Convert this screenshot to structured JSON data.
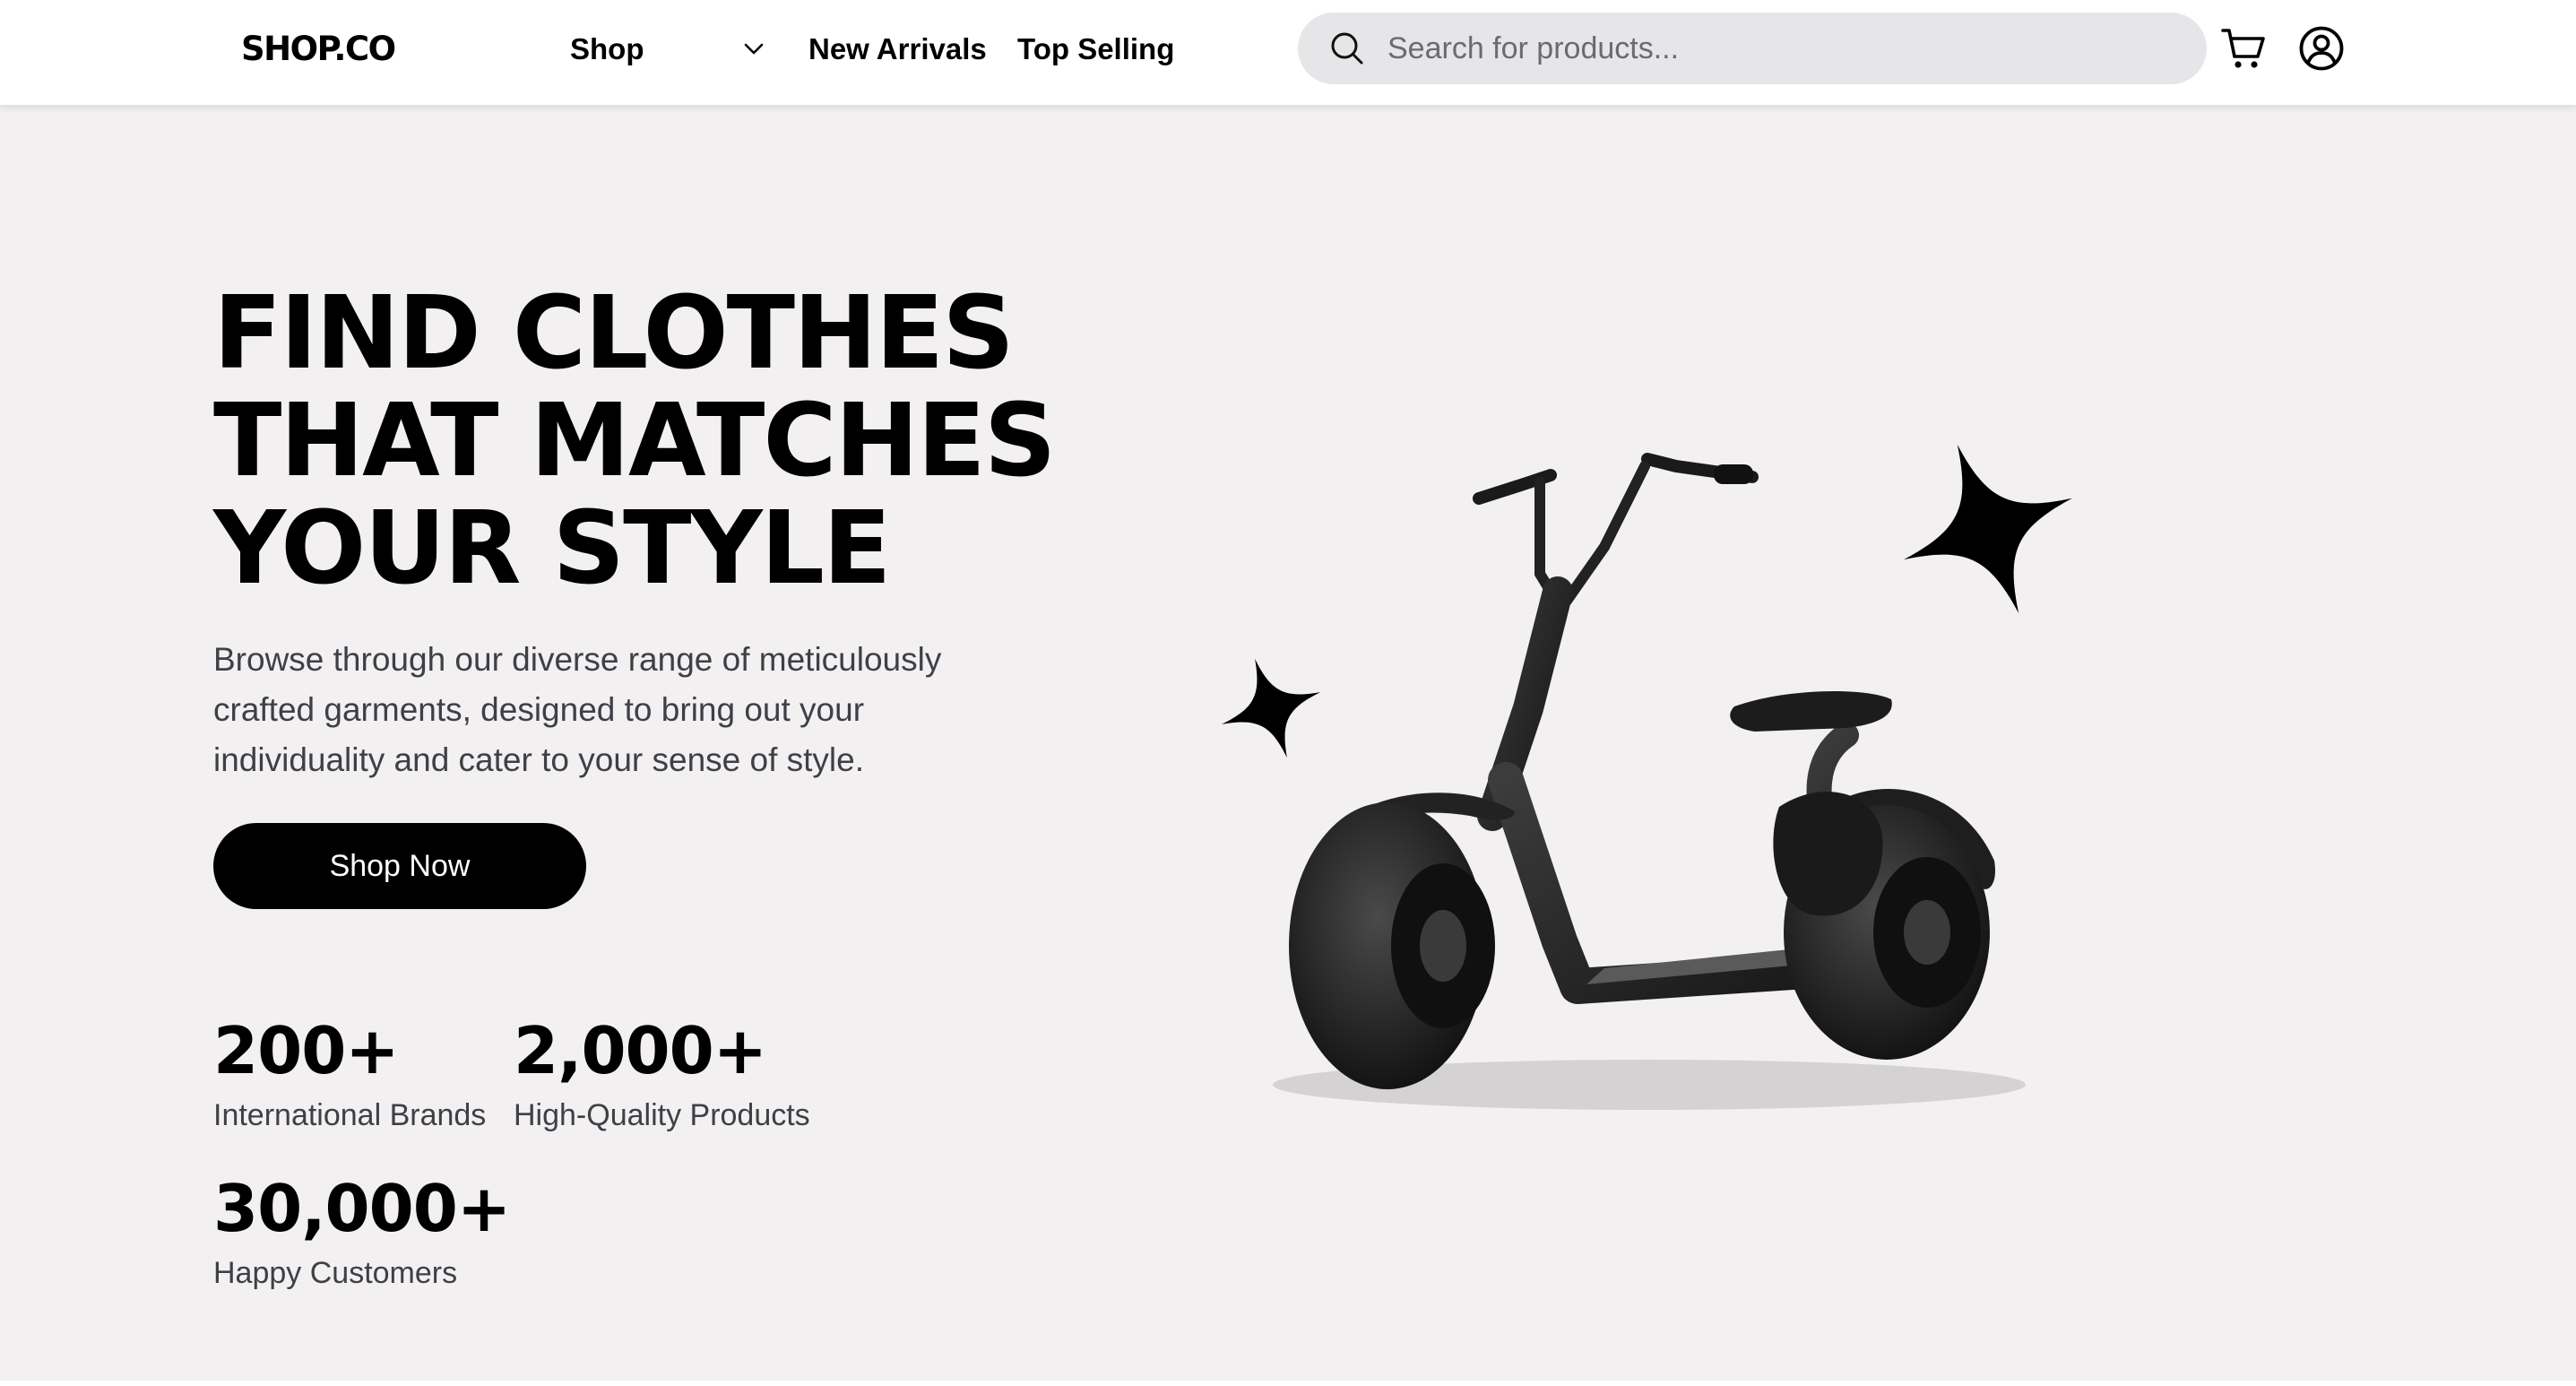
{
  "header": {
    "logo": "SHOP.CO",
    "nav": {
      "shop_label": "Shop",
      "new_arrivals_label": "New Arrivals",
      "top_selling_label": "Top Selling"
    },
    "search": {
      "placeholder": "Search for products..."
    },
    "icons": [
      "search-icon",
      "chevron-down-icon",
      "cart-icon",
      "account-icon"
    ]
  },
  "hero": {
    "title_lines": [
      "FIND CLOTHES",
      "THAT MATCHES",
      "YOUR STYLE"
    ],
    "description": "Browse through our diverse range of meticulously crafted garments, designed to bring out your individuality and cater to your sense of style.",
    "cta_label": "Shop Now",
    "stats": [
      {
        "value": "200+",
        "label": "International Brands"
      },
      {
        "value": "2,000+",
        "label": "High-Quality Products"
      },
      {
        "value": "30,000+",
        "label": "Happy Customers"
      }
    ],
    "image": "electric-scooter-image"
  },
  "colors": {
    "page_background": "#f2f0f1",
    "header_background": "#ffffff",
    "search_background": "#e6e6e9",
    "primary": "#000000",
    "body_text": "#3f3f46"
  }
}
